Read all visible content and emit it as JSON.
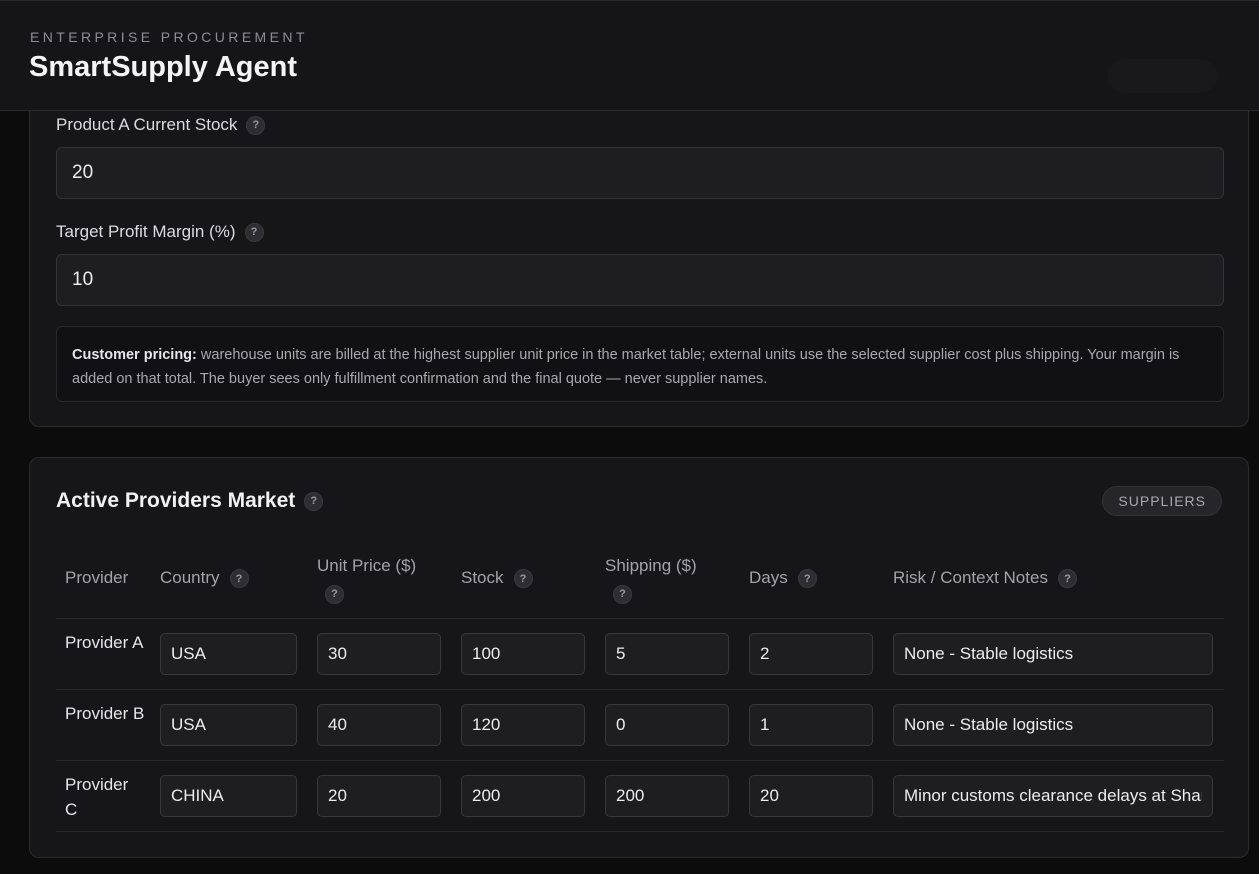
{
  "header": {
    "eyebrow": "ENTERPRISE PROCUREMENT",
    "title": "SmartSupply Agent"
  },
  "settings": {
    "stock_label": "Product A Current Stock",
    "stock_value": "20",
    "margin_label": "Target Profit Margin (%)",
    "margin_value": "10",
    "pricing_note_title": "Customer pricing:",
    "pricing_note_text": "warehouse units are billed at the highest supplier unit price in the market table; external units use the selected supplier cost plus shipping. Your margin is added on that total. The buyer sees only fulfillment confirmation and the final quote — never supplier names."
  },
  "market": {
    "title": "Active Providers Market",
    "badge": "SUPPLIERS",
    "help_glyph": "?",
    "columns": {
      "provider": "Provider",
      "country": "Country",
      "unit_price": "Unit Price ($)",
      "stock": "Stock",
      "shipping": "Shipping ($)",
      "days": "Days",
      "notes": "Risk / Context Notes"
    },
    "rows": [
      {
        "provider": "Provider A",
        "country": "USA",
        "unit_price": "30",
        "stock": "100",
        "shipping": "5",
        "days": "2",
        "notes": "None - Stable logistics"
      },
      {
        "provider": "Provider B",
        "country": "USA",
        "unit_price": "40",
        "stock": "120",
        "shipping": "0",
        "days": "1",
        "notes": "None - Stable logistics"
      },
      {
        "provider": "Provider C",
        "country": "CHINA",
        "unit_price": "20",
        "stock": "200",
        "shipping": "200",
        "days": "20",
        "notes": "Minor customs clearance delays at Shanghai port"
      }
    ]
  }
}
